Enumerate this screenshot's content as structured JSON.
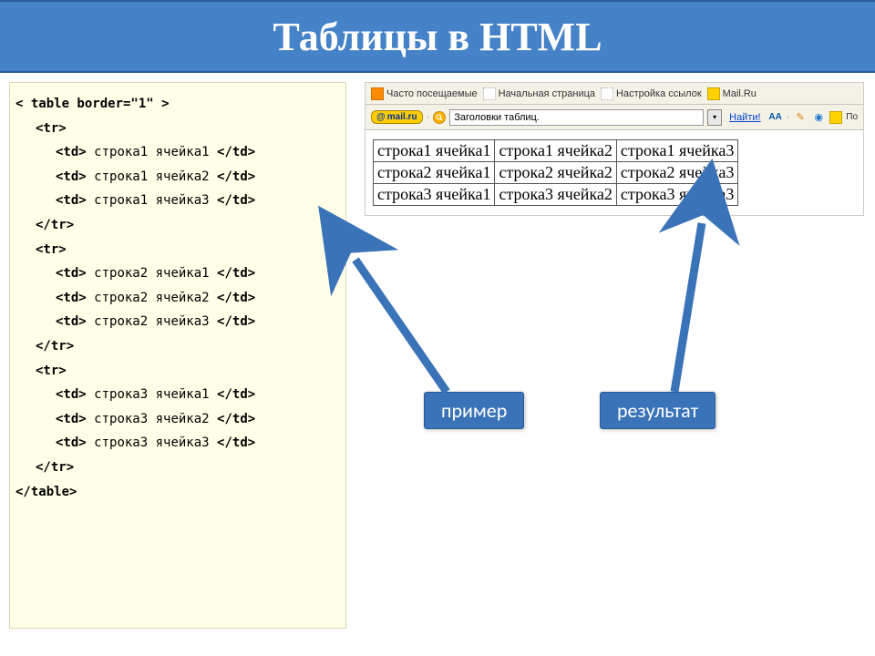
{
  "title": "Таблицы в HTML",
  "code": {
    "open": "< table border=\"1\" >",
    "tr_open": "<tr>",
    "tr_close": "</tr>",
    "table_close": "</table>",
    "cells": {
      "r1c1": "строка1 ячейка1",
      "r1c2": "строка1 ячейка2",
      "r1c3": "строка1 ячейка3",
      "r2c1": "строка2 ячейка1",
      "r2c2": "строка2 ячейка2",
      "r2c3": "строка2 ячейка3",
      "r3c1": "строка3 ячейка1",
      "r3c2": "строка3 ячейка2",
      "r3c3": "строка3 ячейка3"
    },
    "td_open": "<td>",
    "td_close": "</td>"
  },
  "browser": {
    "bookmarks": {
      "frequent": "Часто посещаемые",
      "home": "Начальная страница",
      "links": "Настройка ссылок",
      "mailru": "Mail.Ru"
    },
    "search": {
      "logo_at": "@",
      "logo_text": "mail.ru",
      "value": "Заголовки таблиц.",
      "find": "Найти!",
      "aa": "AA",
      "po": "По"
    }
  },
  "result_table": [
    [
      "строка1 ячейка1",
      "строка1 ячейка2",
      "строка1 ячейка3"
    ],
    [
      "строка2 ячейка1",
      "строка2 ячейка2",
      "строка2 ячейка3"
    ],
    [
      "строка3 ячейка1",
      "строка3 ячейка2",
      "строка3 ячейка3"
    ]
  ],
  "labels": {
    "example": "пример",
    "result": "результат"
  }
}
